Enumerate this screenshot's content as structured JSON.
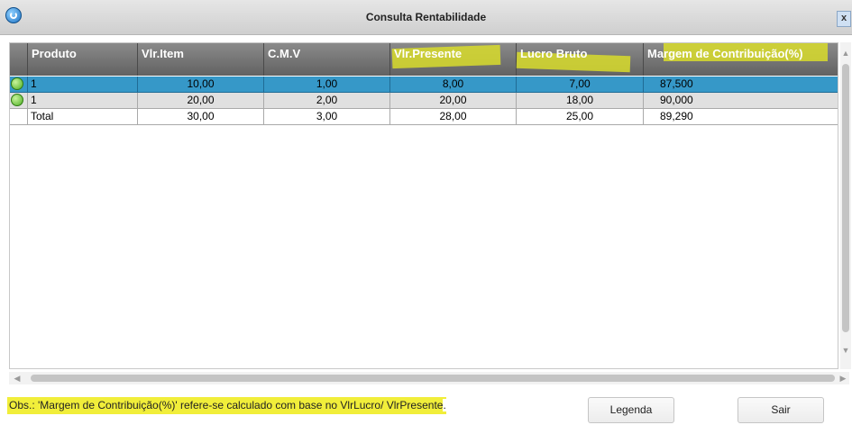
{
  "window": {
    "title": "Consulta Rentabilidade",
    "close_label": "x"
  },
  "grid": {
    "columns": [
      "Produto",
      "Vlr.Item",
      "C.M.V",
      "Vlr.Presente",
      "Lucro Bruto",
      "Margem de Contribuição(%)"
    ],
    "highlighted_columns": [
      "Vlr.Presente",
      "Lucro Bruto",
      "Margem de Contribuição(%)"
    ],
    "rows": [
      {
        "status_icon": "green-status-icon",
        "produto": "1",
        "vlr_item": "10,00",
        "cmv": "1,00",
        "vlr_presente": "8,00",
        "lucro_bruto": "7,00",
        "margem": "87,500",
        "selected": true
      },
      {
        "status_icon": "green-status-icon",
        "produto": "1",
        "vlr_item": "20,00",
        "cmv": "2,00",
        "vlr_presente": "20,00",
        "lucro_bruto": "18,00",
        "margem": "90,000",
        "selected": false
      }
    ],
    "total": {
      "produto": "Total",
      "vlr_item": "30,00",
      "cmv": "3,00",
      "vlr_presente": "28,00",
      "lucro_bruto": "25,00",
      "margem": "89,290"
    }
  },
  "footer": {
    "note_highlighted": "Obs.: 'Margem de Contribuição(%)' refere-se calculado com base no VlrLucro/ VlrPresente",
    "note_tail": ".",
    "legend_button": "Legenda",
    "exit_button": "Sair"
  },
  "colors": {
    "header_bg": "#6e6e6e",
    "selected_row": "#3698c8",
    "highlighter": "#d8dc2c",
    "status_green": "#4cae22"
  }
}
